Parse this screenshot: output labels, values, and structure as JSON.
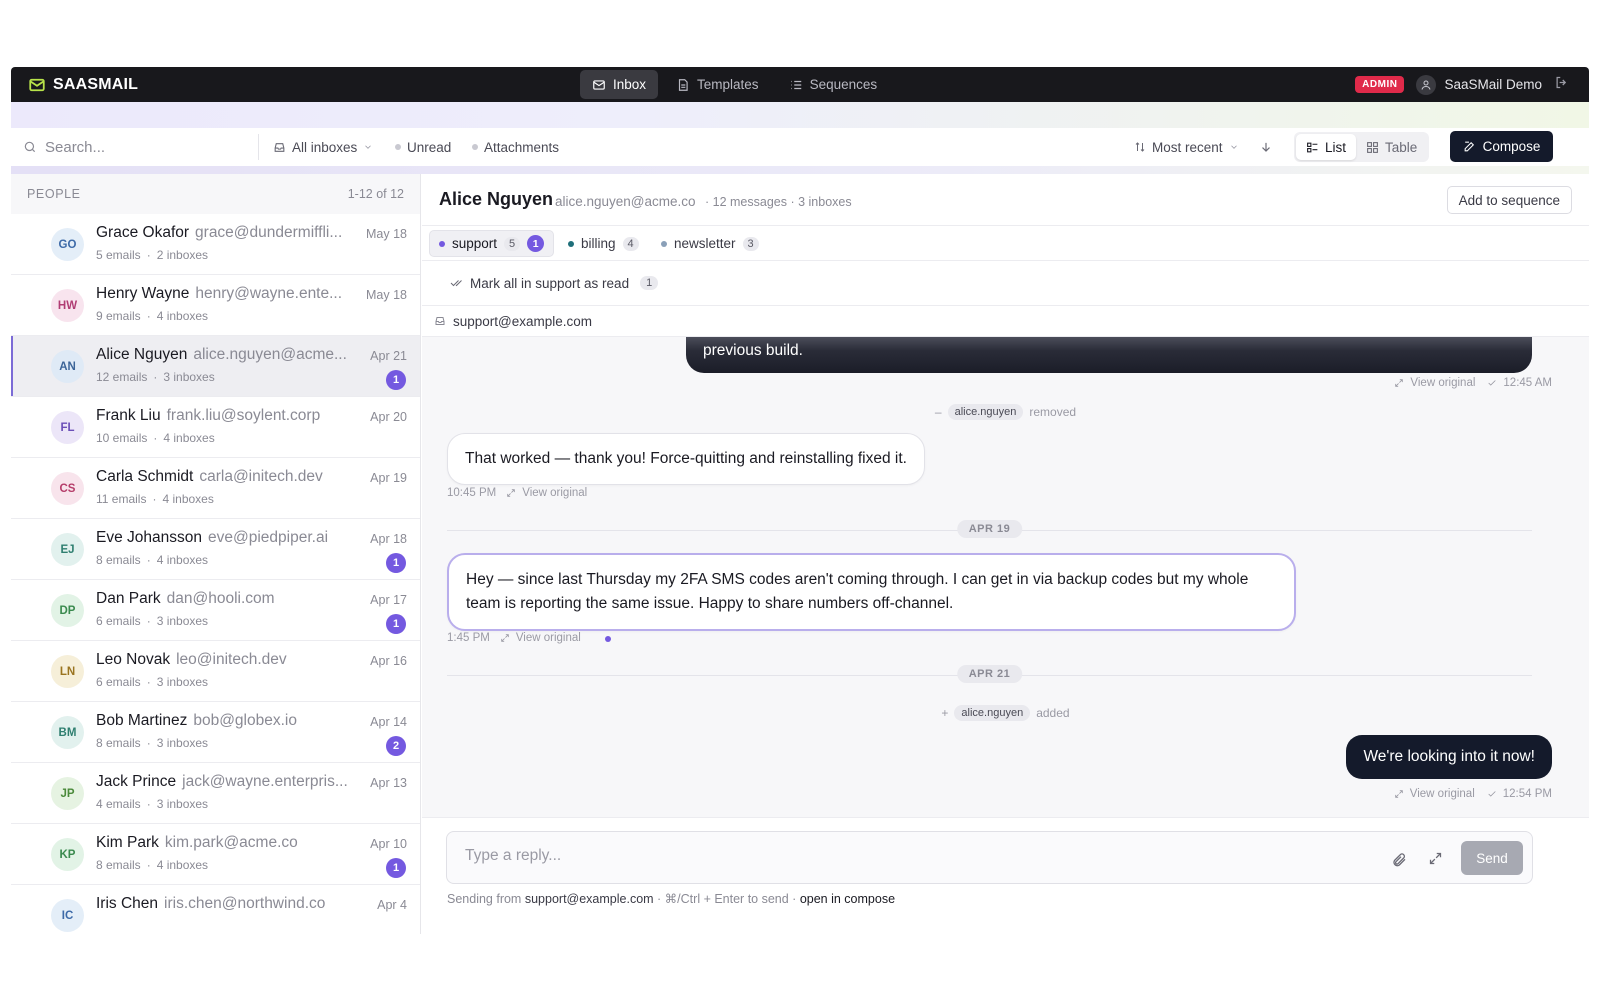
{
  "brand": {
    "name": "SAASMAIL"
  },
  "nav": [
    {
      "label": "Inbox",
      "active": true
    },
    {
      "label": "Templates"
    },
    {
      "label": "Sequences"
    }
  ],
  "user": {
    "badge": "ADMIN",
    "name": "SaaSMail Demo"
  },
  "toolbar": {
    "search_placeholder": "Search...",
    "inbox_filter": "All inboxes",
    "unread": "Unread",
    "attachments": "Attachments",
    "sort": "Most recent",
    "view_list": "List",
    "view_table": "Table",
    "compose": "Compose"
  },
  "people": {
    "header": "PEOPLE",
    "count": "1-12 of 12",
    "items": [
      {
        "initials": "GO",
        "name": "Grace Okafor",
        "email": "grace@dundermiffli...",
        "emails": "5 emails",
        "inboxes": "2 inboxes",
        "date": "May 18",
        "unread": "",
        "bg": "#e4eef8",
        "fg": "#3d6aa8"
      },
      {
        "initials": "HW",
        "name": "Henry Wayne",
        "email": "henry@wayne.ente...",
        "emails": "9 emails",
        "inboxes": "4 inboxes",
        "date": "May 18",
        "unread": "",
        "bg": "#f8e4ee",
        "fg": "#b13d74"
      },
      {
        "initials": "AN",
        "name": "Alice Nguyen",
        "email": "alice.nguyen@acme...",
        "emails": "12 emails",
        "inboxes": "3 inboxes",
        "date": "Apr 21",
        "unread": "1",
        "bg": "#dfeaf6",
        "fg": "#3b6498"
      },
      {
        "initials": "FL",
        "name": "Frank Liu",
        "email": "frank.liu@soylent.corp",
        "emails": "10 emails",
        "inboxes": "4 inboxes",
        "date": "Apr 20",
        "unread": "",
        "bg": "#ece6f8",
        "fg": "#6b4fb8"
      },
      {
        "initials": "CS",
        "name": "Carla Schmidt",
        "email": "carla@initech.dev",
        "emails": "11 emails",
        "inboxes": "4 inboxes",
        "date": "Apr 19",
        "unread": "",
        "bg": "#f8e4ec",
        "fg": "#b53d6a"
      },
      {
        "initials": "EJ",
        "name": "Eve Johansson",
        "email": "eve@piedpiper.ai",
        "emails": "8 emails",
        "inboxes": "4 inboxes",
        "date": "Apr 18",
        "unread": "1",
        "bg": "#e2f1ee",
        "fg": "#2f7f70"
      },
      {
        "initials": "DP",
        "name": "Dan Park",
        "email": "dan@hooli.com",
        "emails": "6 emails",
        "inboxes": "3 inboxes",
        "date": "Apr 17",
        "unread": "1",
        "bg": "#e2f3e6",
        "fg": "#3a8a4e"
      },
      {
        "initials": "LN",
        "name": "Leo Novak",
        "email": "leo@initech.dev",
        "emails": "6 emails",
        "inboxes": "3 inboxes",
        "date": "Apr 16",
        "unread": "",
        "bg": "#f6efd9",
        "fg": "#9a7420"
      },
      {
        "initials": "BM",
        "name": "Bob Martinez",
        "email": "bob@globex.io",
        "emails": "8 emails",
        "inboxes": "3 inboxes",
        "date": "Apr 14",
        "unread": "2",
        "bg": "#e2f1ee",
        "fg": "#2f7f70"
      },
      {
        "initials": "JP",
        "name": "Jack Prince",
        "email": "jack@wayne.enterpris...",
        "emails": "4 emails",
        "inboxes": "3 inboxes",
        "date": "Apr 13",
        "unread": "",
        "bg": "#e6f3e2",
        "fg": "#4a8a3a"
      },
      {
        "initials": "KP",
        "name": "Kim Park",
        "email": "kim.park@acme.co",
        "emails": "8 emails",
        "inboxes": "4 inboxes",
        "date": "Apr 10",
        "unread": "1",
        "bg": "#e2f3e6",
        "fg": "#3a8a4e"
      },
      {
        "initials": "IC",
        "name": "Iris Chen",
        "email": "iris.chen@northwind.co",
        "emails": "",
        "inboxes": "",
        "date": "Apr 4",
        "unread": "",
        "bg": "#e4eef8",
        "fg": "#3d6aa8"
      }
    ]
  },
  "contact": {
    "name": "Alice Nguyen",
    "email": "alice.nguyen@acme.co",
    "stats": "· 12 messages · 3 inboxes",
    "add_to_sequence": "Add to sequence"
  },
  "tabs": [
    {
      "label": "support",
      "count": "5",
      "unread": "1",
      "dot": "#7459e0",
      "active": true
    },
    {
      "label": "billing",
      "count": "4",
      "dot": "#1f6f7a"
    },
    {
      "label": "newsletter",
      "count": "3",
      "dot": "#8aa0b8"
    }
  ],
  "mark_all": {
    "label": "Mark all in support as read",
    "count": "1"
  },
  "from_address": "support@example.com",
  "thread": {
    "msg1_text": "previous build.",
    "msg1_view": "View original",
    "msg1_time": "12:45 AM",
    "event1_tag": "alice.nguyen",
    "event1_text": "removed",
    "event1_sign": "–",
    "msg2_text": "That worked — thank you! Force-quitting and reinstalling fixed it.",
    "msg2_time": "10:45 PM",
    "msg2_view": "View original",
    "date1": "APR 19",
    "msg3_line1": "Hey — since last Thursday my 2FA SMS codes aren't coming through. I can get in via backup codes but my whole",
    "msg3_line2": "team is reporting the same issue. Happy to share numbers off-channel.",
    "msg3_time": "1:45 PM",
    "msg3_view": "View original",
    "date2": "APR 21",
    "event2_sign": "+",
    "event2_tag": "alice.nguyen",
    "event2_text": "added",
    "msg4_text": "We're looking into it now!",
    "msg4_view": "View original",
    "msg4_time": "12:54 PM"
  },
  "reply": {
    "placeholder": "Type a reply...",
    "send": "Send",
    "hint_prefix": "Sending from",
    "hint_from": "support@example.com",
    "hint_mid": "· ⌘/Ctrl + Enter to send ·",
    "hint_link": "open in compose"
  },
  "colors": {
    "accent": "#7459e0",
    "dark": "#141a2b",
    "admin": "#e02a4a",
    "brand_icon": "#b8e34a"
  }
}
